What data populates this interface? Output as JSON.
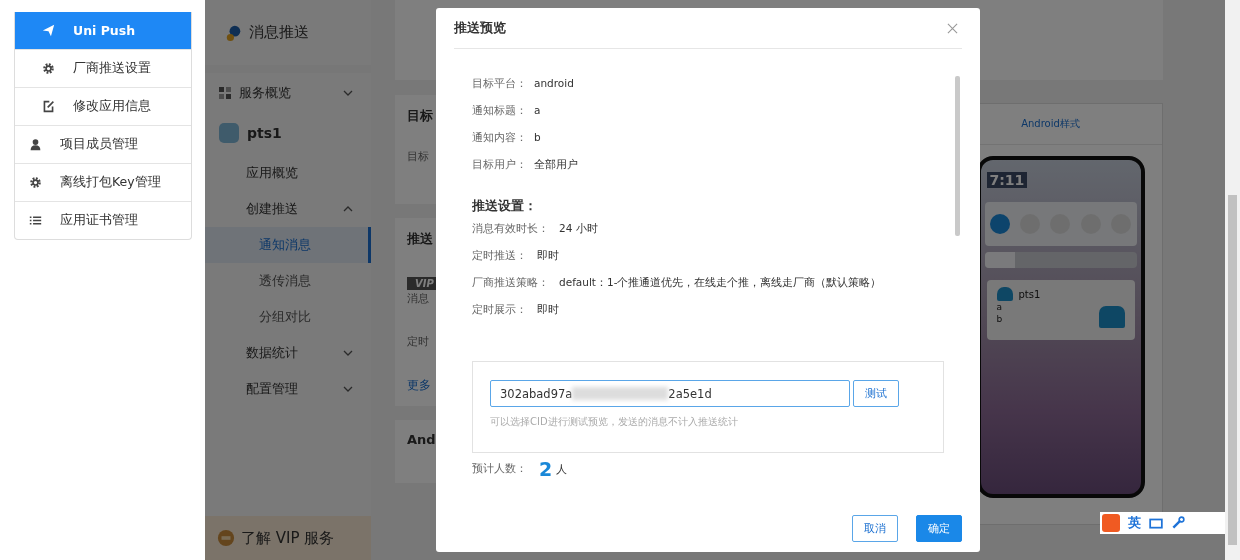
{
  "left_menu": {
    "sub_items": [
      {
        "label": "Uni Push",
        "selected": true
      },
      {
        "label": "厂商推送设置",
        "selected": false
      },
      {
        "label": "修改应用信息",
        "selected": false
      }
    ],
    "items": [
      {
        "label": "项目成员管理",
        "selected": false
      },
      {
        "label": "离线打包Key管理",
        "selected": false
      },
      {
        "label": "应用证书管理",
        "selected": false
      }
    ]
  },
  "sidebar": {
    "title": "消息推送",
    "items": [
      {
        "label": "服务概览",
        "kind": "section",
        "expanded": false
      },
      {
        "label": "pts1",
        "kind": "app"
      },
      {
        "label": "应用概览",
        "kind": "link"
      },
      {
        "label": "创建推送",
        "kind": "section",
        "expanded": true,
        "children": [
          {
            "label": "通知消息",
            "selected": true
          },
          {
            "label": "透传消息",
            "selected": false
          },
          {
            "label": "分组对比",
            "selected": false
          }
        ]
      },
      {
        "label": "数据统计",
        "kind": "section",
        "expanded": false
      },
      {
        "label": "配置管理",
        "kind": "section",
        "expanded": false
      }
    ],
    "vip": "了解 VIP 服务"
  },
  "content": {
    "cards": [
      {
        "title": "目标",
        "rows": [
          "目标"
        ]
      },
      {
        "title": "推送",
        "badge": "VIP",
        "rows": [
          "消息",
          "定时"
        ],
        "link": "更多"
      },
      {
        "title": "And"
      }
    ],
    "preview": {
      "tab": "Android样式",
      "phone": {
        "time": "7:11",
        "brightness": {
          "level": 0.2
        },
        "app": "pts1",
        "title": "a",
        "body": "b"
      }
    }
  },
  "dialog": {
    "title": "推送预览",
    "details": [
      {
        "label": "目标平台：",
        "value": "android"
      },
      {
        "label": "通知标题：",
        "value": "a"
      },
      {
        "label": "通知内容：",
        "value": "b"
      },
      {
        "label": "目标用户：",
        "value": "全部用户"
      }
    ],
    "settings_heading": "推送设置：",
    "settings": [
      {
        "label": "消息有效时长：",
        "value": "24 小时"
      },
      {
        "label": "定时推送：",
        "value": "即时"
      },
      {
        "label": "厂商推送策略：",
        "value": "default：1-个推通道优先，在线走个推，离线走厂商（默认策略）"
      },
      {
        "label": "定时展示：",
        "value": "即时"
      }
    ],
    "cid": {
      "value_start": "302abad97a",
      "value_end": "2a5e1d",
      "button": "测试",
      "hint": "可以选择CID进行测试预览，发送的消息不计入推送统计"
    },
    "estimate": {
      "label": "预计人数：",
      "count": "2",
      "unit": "人"
    },
    "buttons": [
      {
        "label": "取消",
        "kind": "secondary"
      },
      {
        "label": "确定",
        "kind": "primary"
      }
    ]
  },
  "ime_bar": {
    "mode": "英"
  }
}
